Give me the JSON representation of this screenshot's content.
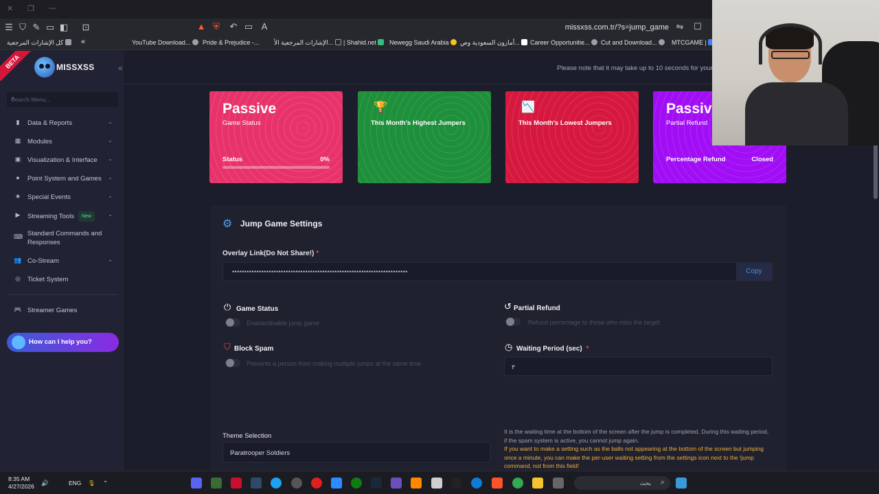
{
  "browser": {
    "url": "missxss.com.tr/?s=jump_game",
    "bookmarks": [
      {
        "label": "كل الإشارات المرجعية",
        "color": "#9aa0a6"
      },
      {
        "label": "YouTube Download...",
        "color": "#ff2d2d"
      },
      {
        "label": "Pride & Prejudice -...",
        "color": "#4285f4"
      },
      {
        "label": "الإشارات المرجعية الأ...",
        "color": "#9aa0a6"
      },
      {
        "label": "| Shahid.net",
        "color": "#2ec27e"
      },
      {
        "label": "Newegg Saudi Arabia",
        "color": "#f5c518"
      },
      {
        "label": "أمازون السعودية وص...",
        "color": "#ffffff"
      },
      {
        "label": "Career Opportunitie...",
        "color": "#9aa0a6"
      },
      {
        "label": "Cut and Download...",
        "color": "#9aa0a6"
      },
      {
        "label": "MTCGAME |",
        "color": "#3b82f6"
      }
    ]
  },
  "app": {
    "beta": "BETA",
    "logo": "MISSXSS",
    "notice": "Please note that it may take up to 10 seconds for your c",
    "search_placeholder": "Search Menu..."
  },
  "sidebar": {
    "items": [
      {
        "label": "Data & Reports",
        "icon": "chart-icon"
      },
      {
        "label": "Modules",
        "icon": "grid-icon"
      },
      {
        "label": "Visualization & Interface",
        "icon": "calendar-icon"
      },
      {
        "label": "Point System and Games",
        "icon": "coin-icon"
      },
      {
        "label": "Special Events",
        "icon": "star-icon"
      },
      {
        "label": "Streaming Tools",
        "icon": "video-icon",
        "badge": "New"
      },
      {
        "label": "Standard Commands and Responses",
        "icon": "keyboard-icon"
      },
      {
        "label": "Co-Stream",
        "icon": "users-icon"
      },
      {
        "label": "Ticket System",
        "icon": "support-icon"
      },
      {
        "label": "Streamer Games",
        "icon": "gamepad-icon"
      }
    ],
    "help": "How can I help you?"
  },
  "cards": [
    {
      "title": "Passive",
      "subtitle": "Game Status",
      "foot_label": "Status",
      "foot_value": "0%",
      "progress": 0,
      "color": "#e8336a"
    },
    {
      "icon": "🏆",
      "subtitle": "This Month's Highest Jumpers",
      "color": "#1e8f3a"
    },
    {
      "icon": "📉",
      "subtitle": "This Month's Lowest Jumpers",
      "color": "#d6183f"
    },
    {
      "title": "Passive",
      "subtitle": "Partial Refund",
      "foot_label": "Percentage Refund",
      "foot_value": "Closed",
      "color": "#a10df5"
    }
  ],
  "settings": {
    "title": "Jump Game Settings",
    "overlay_label": "Overlay Link(Do Not Share!)",
    "overlay_value": "••••••••••••••••••••••••••••••••••••••••••••••••••••••••••••••••••••••••",
    "copy": "Copy",
    "game_status": {
      "title": "Game Status",
      "desc": "Enable/disable jump game"
    },
    "partial_refund": {
      "title": "Partial Refund",
      "desc": "Refund percentage to those who miss the target"
    },
    "block_spam": {
      "title": "Block Spam",
      "desc": "Prevents a person from making multiple jumps at the same time"
    },
    "waiting": {
      "title": "Waiting Period (sec)",
      "value": "٣",
      "help": "It is the waiting time at the bottom of the screen after the jump is completed. During this waiting period, if the spam system is active, you cannot jump again.",
      "warning": "If you want to make a setting such as the balls not appearing at the bottom of the screen but jumping once a minute, you can make the per-user waiting setting from the settings icon next to the !jump command, not from this field!"
    },
    "theme_label": "Theme Selection",
    "theme_value": "Paratrooper Soldiers"
  },
  "taskbar": {
    "time": "8:35 AM",
    "date": "4/27/2026",
    "lang": "ENG",
    "search": "بحث"
  }
}
